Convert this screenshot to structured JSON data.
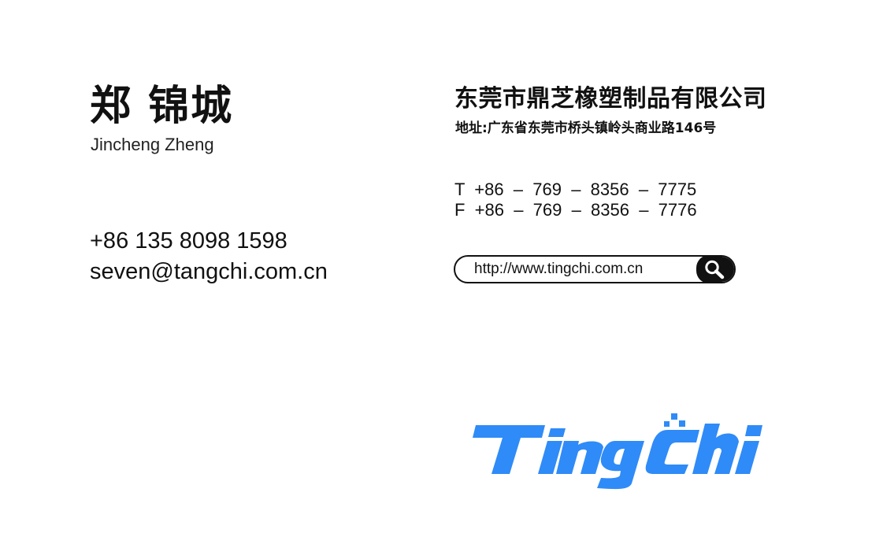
{
  "person": {
    "name_cn": "郑 锦城",
    "name_en": "Jincheng Zheng",
    "mobile": "+86 135 8098 1598",
    "email": "seven@tangchi.com.cn"
  },
  "company": {
    "name": "东莞市鼎芝橡塑制品有限公司",
    "address": "地址:广东省东莞市桥头镇岭头商业路146号",
    "tel": "T  +86  –  769  –  8356  –  7775",
    "fax": "F  +86  –  769  –  8356  –  7776"
  },
  "website": {
    "url": "http://www.tingchi.com.cn",
    "search_icon": "magnifier-icon"
  },
  "logo": {
    "text": "TingChi",
    "color": "#2f8bf7"
  },
  "colors": {
    "text": "#111111",
    "background": "#ffffff",
    "brand": "#2f8bf7"
  }
}
